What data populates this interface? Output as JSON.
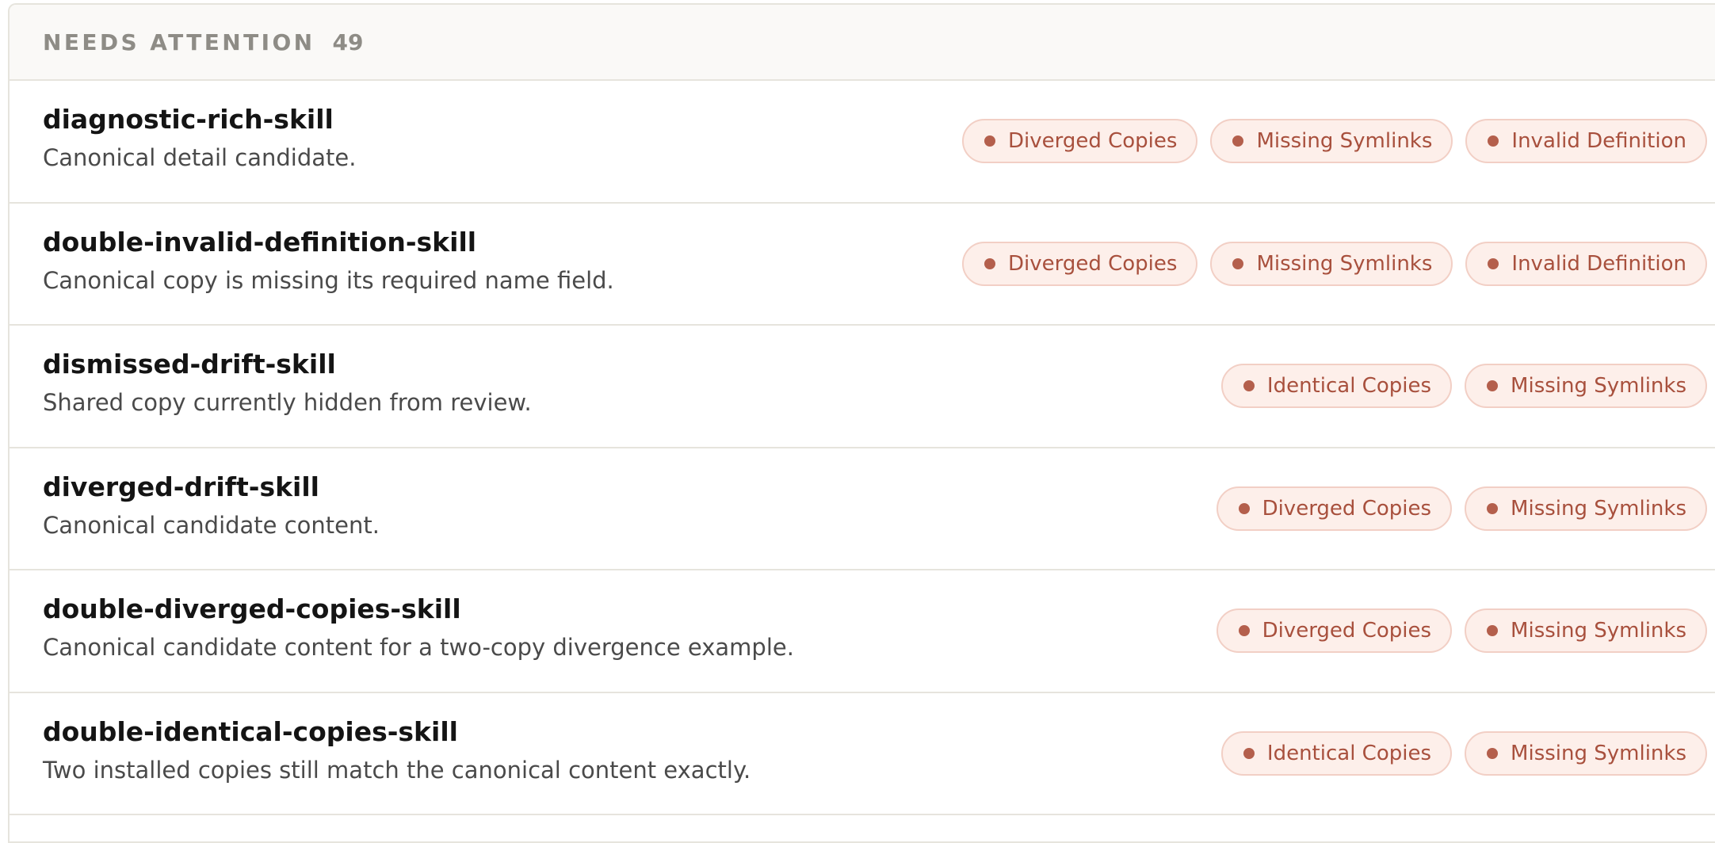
{
  "section": {
    "title": "NEEDS ATTENTION",
    "count": "49"
  },
  "colors": {
    "badge_background": "#fdefea",
    "badge_border": "#f2cfc5",
    "badge_text": "#a8503d",
    "badge_dot": "#b45f4c"
  },
  "skills": [
    {
      "name": "diagnostic-rich-skill",
      "description": "Canonical detail candidate.",
      "badges": [
        "Diverged Copies",
        "Missing Symlinks",
        "Invalid Definition"
      ]
    },
    {
      "name": "double-invalid-definition-skill",
      "description": "Canonical copy is missing its required name field.",
      "badges": [
        "Diverged Copies",
        "Missing Symlinks",
        "Invalid Definition"
      ]
    },
    {
      "name": "dismissed-drift-skill",
      "description": "Shared copy currently hidden from review.",
      "badges": [
        "Identical Copies",
        "Missing Symlinks"
      ]
    },
    {
      "name": "diverged-drift-skill",
      "description": "Canonical candidate content.",
      "badges": [
        "Diverged Copies",
        "Missing Symlinks"
      ]
    },
    {
      "name": "double-diverged-copies-skill",
      "description": "Canonical candidate content for a two-copy divergence example.",
      "badges": [
        "Diverged Copies",
        "Missing Symlinks"
      ]
    },
    {
      "name": "double-identical-copies-skill",
      "description": "Two installed copies still match the canonical content exactly.",
      "badges": [
        "Identical Copies",
        "Missing Symlinks"
      ]
    }
  ]
}
